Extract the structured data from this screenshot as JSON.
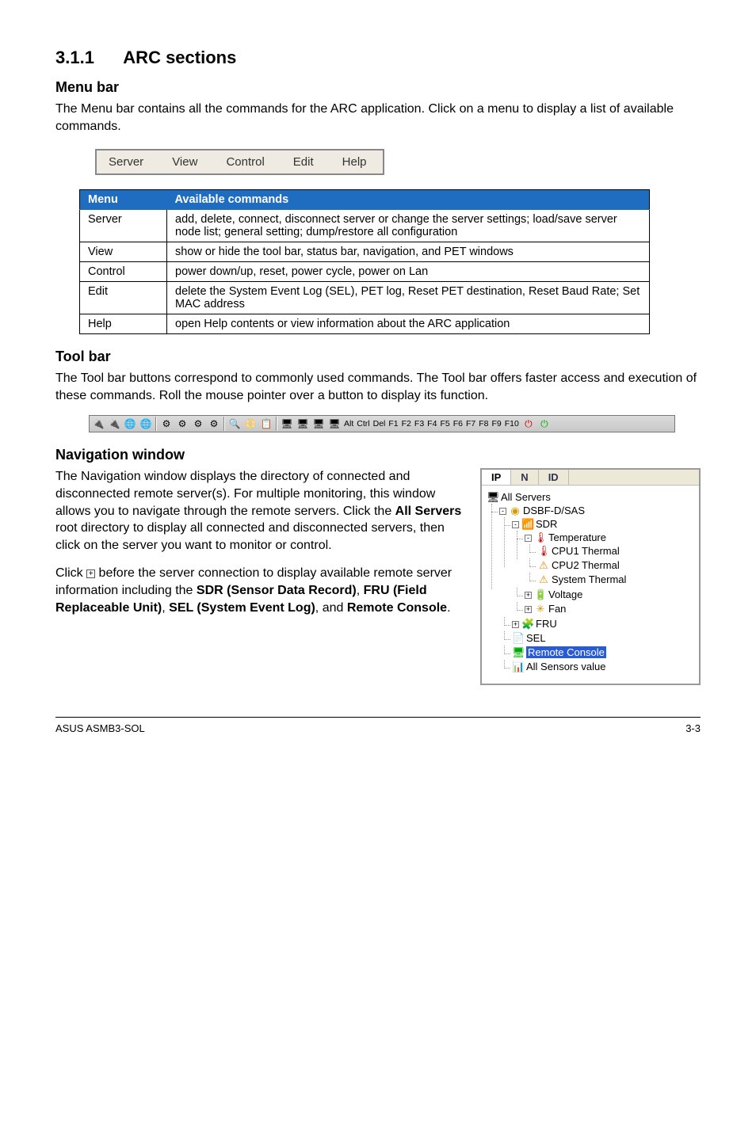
{
  "section": {
    "number": "3.1.1",
    "title": "ARC sections"
  },
  "menu_bar_heading": "Menu bar",
  "menu_bar_text": "The Menu bar contains all the commands for the ARC application. Click on a menu to display a list of available commands.",
  "menu_items": [
    "Server",
    "View",
    "Control",
    "Edit",
    "Help"
  ],
  "table": {
    "head": [
      "Menu",
      "Available commands"
    ],
    "rows": [
      [
        "Server",
        "add, delete, connect, disconnect server or change the server settings; load/save server node list; general setting; dump/restore all configuration"
      ],
      [
        "View",
        "show or hide the tool bar, status bar, navigation, and PET windows"
      ],
      [
        "Control",
        "power down/up, reset, power cycle, power on Lan"
      ],
      [
        "Edit",
        "delete the System Event Log (SEL), PET log, Reset PET destination, Reset Baud Rate; Set MAC address"
      ],
      [
        "Help",
        "open Help contents or view information about the ARC application"
      ]
    ]
  },
  "tool_bar_heading": "Tool bar",
  "tool_bar_text": "The Tool bar buttons correspond to commonly used commands. The Tool bar offers faster access and execution of these commands. Roll the mouse pointer over a button to display its function.",
  "tool_strip_labels": [
    "Alt",
    "Ctrl",
    "Del",
    "F1",
    "F2",
    "F3",
    "F4",
    "F5",
    "F6",
    "F7",
    "F8",
    "F9",
    "F10"
  ],
  "nav_heading": "Navigation window",
  "nav_p1_a": "The Navigation window displays the directory of connected and disconnected remote server(s). For multiple monitoring, this window allows you to navigate through the remote servers. Click the ",
  "nav_p1_bold1": "All Servers",
  "nav_p1_b": " root directory to display all connected and disconnected servers, then click on the server you want to monitor or control.",
  "nav_p2_a": "Click ",
  "nav_p2_b": " before the server connection to display available remote server information including the ",
  "nav_p2_s1": "SDR (Sensor Data Record)",
  "nav_p2_c": ", ",
  "nav_p2_s2": "FRU (Field Replaceable Unit)",
  "nav_p2_d": ", ",
  "nav_p2_s3": "SEL (System Event Log)",
  "nav_p2_e": ", and ",
  "nav_p2_s4": "Remote Console",
  "nav_p2_f": ".",
  "tree_tabs": [
    "IP",
    "N",
    "ID"
  ],
  "tree": {
    "root": "All Servers",
    "l1": "DSBF-D/SAS",
    "l2_sdr": "SDR",
    "l3_temp": "Temperature",
    "leaf_cpu1": "CPU1 Thermal",
    "leaf_cpu2": "CPU2 Thermal",
    "leaf_sys": "System Thermal",
    "l3_volt": "Voltage",
    "l3_fan": "Fan",
    "l2_fru": "FRU",
    "l2_sel": "SEL",
    "l2_remote": "Remote Console",
    "l2_allsens": "All Sensors value"
  },
  "footer_left": "ASUS ASMB3-SOL",
  "footer_right": "3-3"
}
